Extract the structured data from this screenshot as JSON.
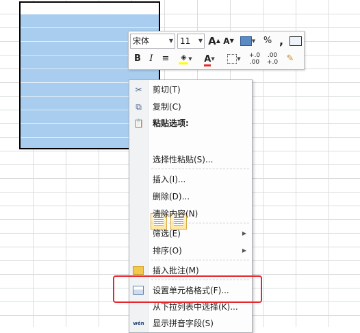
{
  "toolbar": {
    "font_name": "宋体",
    "font_size": "11",
    "grow_font_label": "A",
    "shrink_font_label": "A",
    "percent_label": "%",
    "comma_label": ",",
    "bold_label": "B",
    "italic_label": "I",
    "font_color_label": "A",
    "inc_decimal_label": "+.0 .00",
    "dec_decimal_label": ".00 +.0",
    "font_color": "#e8262c",
    "fill_color": "#ffff00"
  },
  "context_menu": {
    "cut": "剪切(T)",
    "copy": "复制(C)",
    "paste_options": "粘贴选项:",
    "paste_special": "选择性粘贴(S)...",
    "insert": "插入(I)...",
    "delete": "删除(D)...",
    "clear_contents": "清除内容(N)",
    "filter": "筛选(E)",
    "sort": "排序(O)",
    "insert_comment": "插入批注(M)",
    "format_cells": "设置单元格格式(F)...",
    "pick_from_list": "从下拉列表中选择(K)...",
    "show_phonetic": "显示拼音字段(S)"
  },
  "icons": {
    "cut": "scissors-icon",
    "copy": "copy-icon",
    "paste": "clipboard-icon",
    "comment": "folder-comment-icon",
    "format": "format-cells-icon",
    "phonetic": "wen-icon"
  },
  "highlight_color": "#e8262c",
  "selection_color": "#a9cdee"
}
